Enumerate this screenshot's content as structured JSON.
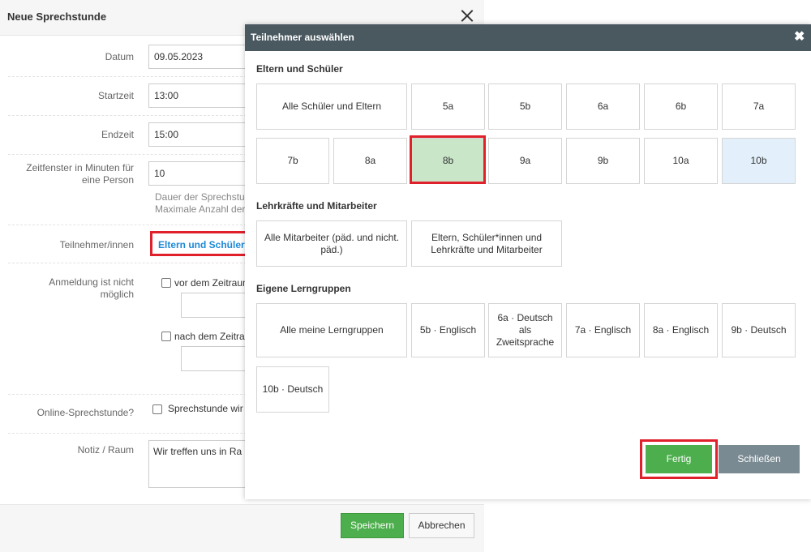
{
  "form": {
    "title": "Neue Sprechstunde",
    "datum_label": "Datum",
    "datum_value": "09.05.2023",
    "startzeit_label": "Startzeit",
    "startzeit_value": "13:00",
    "endzeit_label": "Endzeit",
    "endzeit_value": "15:00",
    "zeitfenster_label_1": "Zeitfenster in Minuten für",
    "zeitfenster_label_2": "eine Person",
    "zeitfenster_value": "10",
    "help_1": "Dauer der Sprechstu",
    "help_2": "Maximale Anzahl der",
    "teilnehmer_label": "Teilnehmer/innen",
    "teilnehmer_value": "Eltern und Schüler",
    "anmeldung_label_1": "Anmeldung ist nicht",
    "anmeldung_label_2": "möglich",
    "vor_label": "vor dem Zeitraum",
    "nach_label": "nach dem Zeitra",
    "online_label": "Online-Sprechstunde?",
    "online_cb_label": "Sprechstunde wir",
    "notiz_label": "Notiz / Raum",
    "notiz_value": "Wir treffen uns in Ra",
    "save_label": "Speichern",
    "cancel_label": "Abbrechen"
  },
  "modal": {
    "title": "Teilnehmer auswählen",
    "close_glyph": "✖",
    "section_1": "Eltern und Schüler",
    "section_2": "Lehrkräfte und Mitarbeiter",
    "section_3": "Eigene Lerngruppen",
    "eltern_tiles": [
      "Alle Schüler und Eltern",
      "5a",
      "5b",
      "6a",
      "6b",
      "7a",
      "7b",
      "8a",
      "8b",
      "9a",
      "9b",
      "10a",
      "10b"
    ],
    "staff_tiles": [
      "Alle Mitarbeiter (päd. und nicht. päd.)",
      "Eltern, Schüler*innen und Lehrkräfte und Mitarbeiter"
    ],
    "group_tiles": [
      "Alle meine Lerngruppen",
      "5b · Englisch",
      "6a · Deutsch als Zweitsprache",
      "7a · Englisch",
      "8a · Englisch",
      "9b · Deutsch",
      "10b · Deutsch"
    ],
    "selected_tile": "8b",
    "highlighted_tile": "10b",
    "fertig_label": "Fertig",
    "schliessen_label": "Schließen"
  },
  "colors": {
    "header": "#4a5860",
    "selected_bg": "#c9e6c9",
    "hover_bg": "#e3f0fb",
    "primary_green": "#4cae4c",
    "secondary_gray": "#7a8a92",
    "link_blue": "#1e8ad6",
    "annotation_red": "#e0202a"
  }
}
